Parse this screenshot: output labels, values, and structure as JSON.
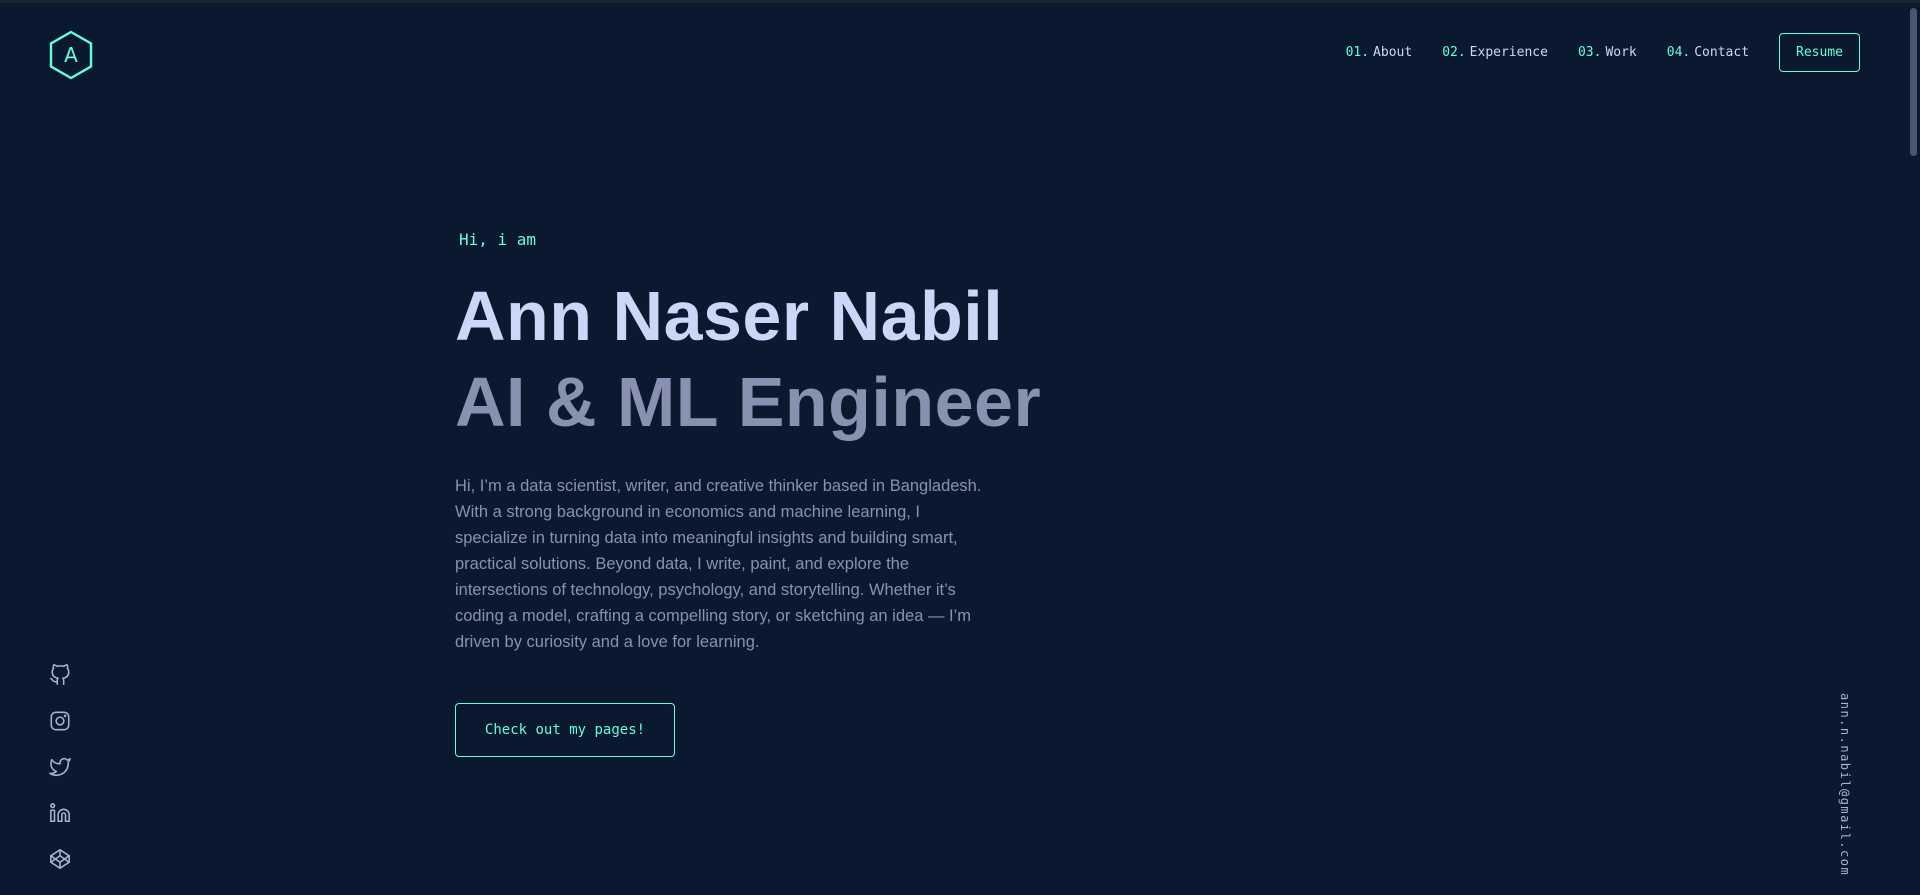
{
  "logo": {
    "letter": "A"
  },
  "nav": {
    "items": [
      {
        "num": "01.",
        "label": "About"
      },
      {
        "num": "02.",
        "label": "Experience"
      },
      {
        "num": "03.",
        "label": "Work"
      },
      {
        "num": "04.",
        "label": "Contact"
      }
    ],
    "resume_label": "Resume"
  },
  "hero": {
    "greeting": "Hi, i am",
    "name": "Ann Naser Nabil",
    "role": "AI & ML Engineer",
    "bio": "Hi, I’m a data scientist, writer, and creative thinker based in Bangladesh. With a strong background in economics and machine learning, I specialize in turning data into meaningful insights and building smart, practical solutions. Beyond data, I write, paint, and explore the intersections of technology, psychology, and storytelling. Whether it’s coding a model, crafting a compelling story, or sketching an idea — I’m driven by curiosity and a love for learning.",
    "cta_label": "Check out my pages!"
  },
  "social": {
    "icons": [
      "github-icon",
      "instagram-icon",
      "twitter-icon",
      "linkedin-icon",
      "codepen-icon"
    ]
  },
  "email": "ann.n.nabil@gmail.com",
  "colors": {
    "background": "#0a192f",
    "accent": "#64ffda",
    "heading": "#ccd6f6",
    "text": "#8892b0"
  }
}
